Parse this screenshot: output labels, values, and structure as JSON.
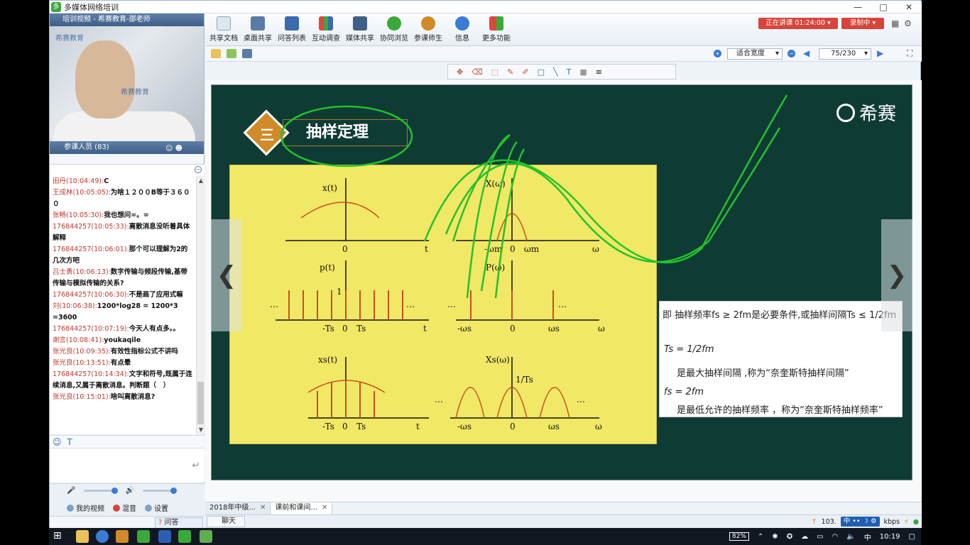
{
  "window": {
    "title": "多媒体网络培训"
  },
  "left": {
    "video_header": "培训视频 - 希赛教育-邵老师",
    "video_watermark": "希赛教育",
    "participants_label": "参课人员 (83)",
    "chat": [
      {
        "who": "田丹(10:04:49):",
        "text": "C"
      },
      {
        "who": "王成林(10:05:05):",
        "text": "为啥１２００B等于３６００"
      },
      {
        "who": "张畅(10:05:30):",
        "text": "我也想问=。="
      },
      {
        "who": "176844257(10:05:33):",
        "text": "离散消息没听着具体解释"
      },
      {
        "who": "176844257(10:06:01):",
        "text": "那个可以理解为2的几次方吧"
      },
      {
        "who": "吕士勇(10:06:13):",
        "text": "数字传输与频段传输,基带传输与模拟传输的关系?"
      },
      {
        "who": "176844257(10:06:30):",
        "text": "不是画了应用式嘛"
      },
      {
        "who": "刘(10:06:38):",
        "text": "1200*log28 = 1200*3 =3600"
      },
      {
        "who": "176844257(10:07:19):",
        "text": "今天人有点多。。"
      },
      {
        "who": "谢言(10:08:41):",
        "text": "youkaqile"
      },
      {
        "who": "张光良(10:09:35):",
        "text": "有效性指标公式不讲吗"
      },
      {
        "who": "张光良(10:13:51):",
        "text": "有点晕"
      },
      {
        "who": "176844257(10:14:34):",
        "text": "文字和符号,既属于连续消息,又属于离散消息。判断题（　）"
      },
      {
        "who": "张光良(10:15:01):",
        "text": "啥叫离散消息?"
      }
    ],
    "my_video": "我的视频",
    "mix": "混音",
    "settings": "设置",
    "qa_tab": "问答"
  },
  "toolbar": {
    "items": [
      "共享文档",
      "桌面共享",
      "问答列表",
      "互动调查",
      "媒体共享",
      "协同浏览",
      "参课师生",
      "信息",
      "更多功能"
    ],
    "live_status": "正在讲课 01:24:00",
    "recording": "录制中"
  },
  "docbar": {
    "fit": "适合宽度",
    "page": "75/230"
  },
  "slide": {
    "logo_text": "希赛",
    "section_num": "三",
    "section_title": "抽样定理",
    "def_line1": "即 抽样频率fs ≥ 2fm是必要条件,或抽样间隔Ts ≤ 1/2fm",
    "formula1": "Ts = 1/2fm",
    "def_line2": "是最大抽样间隔 ,称为“奈奎斯特抽样间隔”",
    "formula2": "fs = 2fm",
    "def_line3": "是最低允许的抽样频率 ，称为“奈奎斯特抽样频率”",
    "plot_labels": {
      "xt": "x(t)",
      "xw": "X(ω)",
      "pt": "p(t)",
      "pw": "P(ω)",
      "xst": "xs(t)",
      "xsw": "Xs(ω)",
      "zero": "0",
      "t": "t",
      "w": "ω",
      "one": "1",
      "oneTs": "1/Ts",
      "dots": "…",
      "neg_wm": "-ωm",
      "wm": "ωm",
      "neg_ts": "-Ts",
      "ts": "Ts",
      "neg_ws": "-ωs",
      "ws": "ωs"
    }
  },
  "doctabs": [
    "2018年中级...",
    "课前和课间..."
  ],
  "status": {
    "chat_tab": "聊天",
    "speed": "103.",
    "ime": "中",
    "unit": "kbps"
  },
  "taskbar": {
    "battery": "82%",
    "time": "10:19",
    "ime": "中"
  }
}
